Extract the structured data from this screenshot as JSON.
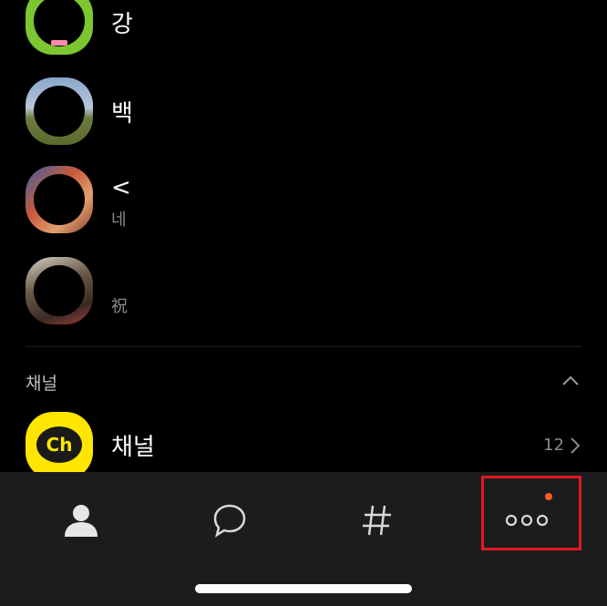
{
  "friends": [
    {
      "name": "강",
      "subtitle": "",
      "ring_color": "#7cc62f"
    },
    {
      "name": "백",
      "subtitle": "",
      "ring_color": "#8aa6c9"
    },
    {
      "name": "<",
      "subtitle": "네",
      "ring_color": "#c85a3a"
    },
    {
      "name": "",
      "subtitle": "祝",
      "ring_color": "#6b5a4a"
    }
  ],
  "channel_section": {
    "title": "채널",
    "channel": {
      "icon_text": "Ch",
      "name": "채널",
      "count": "12"
    }
  },
  "tabbar": {
    "tabs": [
      "friends",
      "chats",
      "open-chat",
      "more"
    ],
    "active_highlight": "more",
    "notification_color": "#ff5a2b",
    "highlight_color": "#e0191e"
  }
}
